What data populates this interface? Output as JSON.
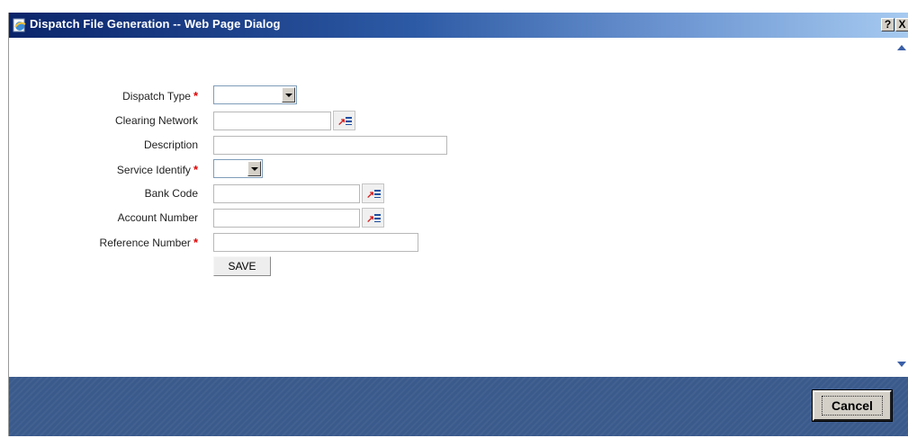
{
  "window": {
    "title": "Dispatch File Generation -- Web Page Dialog",
    "help_label": "?",
    "close_label": "X"
  },
  "form": {
    "dispatch_type": {
      "label": "Dispatch Type",
      "required": "*",
      "value": ""
    },
    "clearing_network": {
      "label": "Clearing Network",
      "value": ""
    },
    "description": {
      "label": "Description",
      "value": ""
    },
    "service_identify": {
      "label": "Service Identify",
      "required": "*",
      "value": ""
    },
    "bank_code": {
      "label": "Bank Code",
      "value": ""
    },
    "account_number": {
      "label": "Account Number",
      "value": ""
    },
    "reference_number": {
      "label": "Reference Number",
      "required": "*",
      "value": ""
    },
    "save_label": "SAVE"
  },
  "footer": {
    "cancel_label": "Cancel"
  },
  "colors": {
    "title_bar_start": "#0a246a",
    "footer_bg": "#3a5a8c",
    "required_mark": "#e00000"
  }
}
